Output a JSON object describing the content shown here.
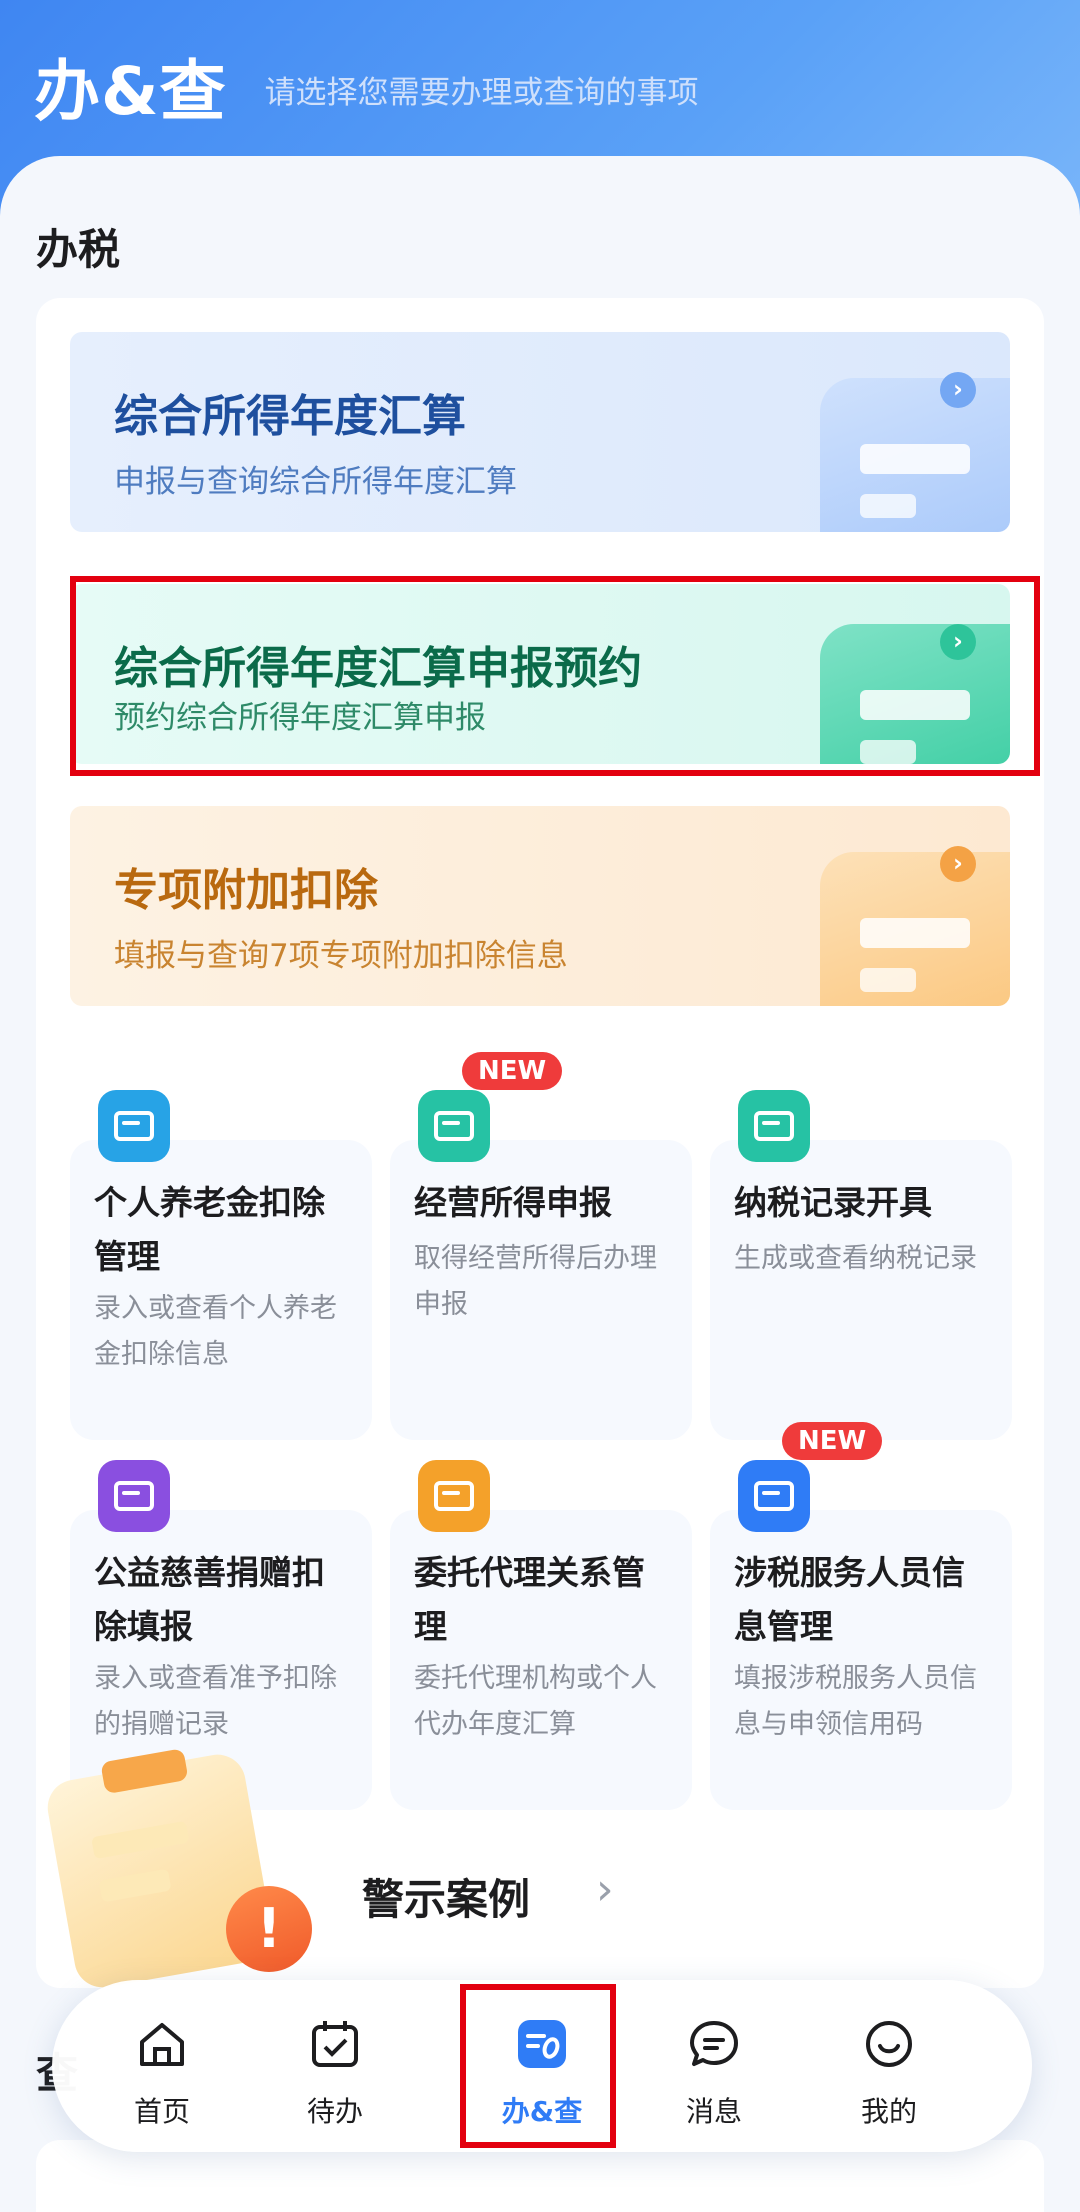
{
  "header": {
    "title": "办&查",
    "subtitle": "请选择您需要办理或查询的事项"
  },
  "section": {
    "title": "办税"
  },
  "banners": [
    {
      "title": "综合所得年度汇算",
      "subtitle": "申报与查询综合所得年度汇算"
    },
    {
      "title": "综合所得年度汇算申报预约",
      "subtitle": "预约综合所得年度汇算申报"
    },
    {
      "title": "专项附加扣除",
      "subtitle": "填报与查询7项专项附加扣除信息"
    }
  ],
  "tiles": [
    {
      "title": "个人养老金扣除管理",
      "desc": "录入或查看个人养老金扣除信息",
      "badge": ""
    },
    {
      "title": "经营所得申报",
      "desc": "取得经营所得后办理申报",
      "badge": "NEW"
    },
    {
      "title": "纳税记录开具",
      "desc": "生成或查看纳税记录",
      "badge": ""
    },
    {
      "title": "公益慈善捐赠扣除填报",
      "desc": "录入或查看准予扣除的捐赠记录",
      "badge": ""
    },
    {
      "title": "委托代理关系管理",
      "desc": "委托代理机构或个人代办年度汇算",
      "badge": ""
    },
    {
      "title": "涉税服务人员信息管理",
      "desc": "填报涉税服务人员信息与申领信用码",
      "badge": "NEW"
    }
  ],
  "warning": {
    "label": "警示案例",
    "arrow": "›"
  },
  "next_section_partial": "查",
  "tabbar": {
    "tabs": [
      {
        "label": "首页",
        "active": false
      },
      {
        "label": "待办",
        "active": false
      },
      {
        "label": "办&查",
        "active": true
      },
      {
        "label": "消息",
        "active": false
      },
      {
        "label": "我的",
        "active": false
      }
    ]
  },
  "colors": {
    "brand_blue": "#3f86f2",
    "highlight_red": "#e3000f",
    "new_badge": "#ef3b3b"
  },
  "icons": {
    "tiles": [
      "card-cny-icon",
      "document-icon",
      "record-icon",
      "charity-heart-icon",
      "handover-icon",
      "id-card-icon"
    ],
    "tabs": [
      "home-icon",
      "calendar-check-icon",
      "task-list-icon",
      "chat-bubble-icon",
      "smile-icon"
    ]
  }
}
